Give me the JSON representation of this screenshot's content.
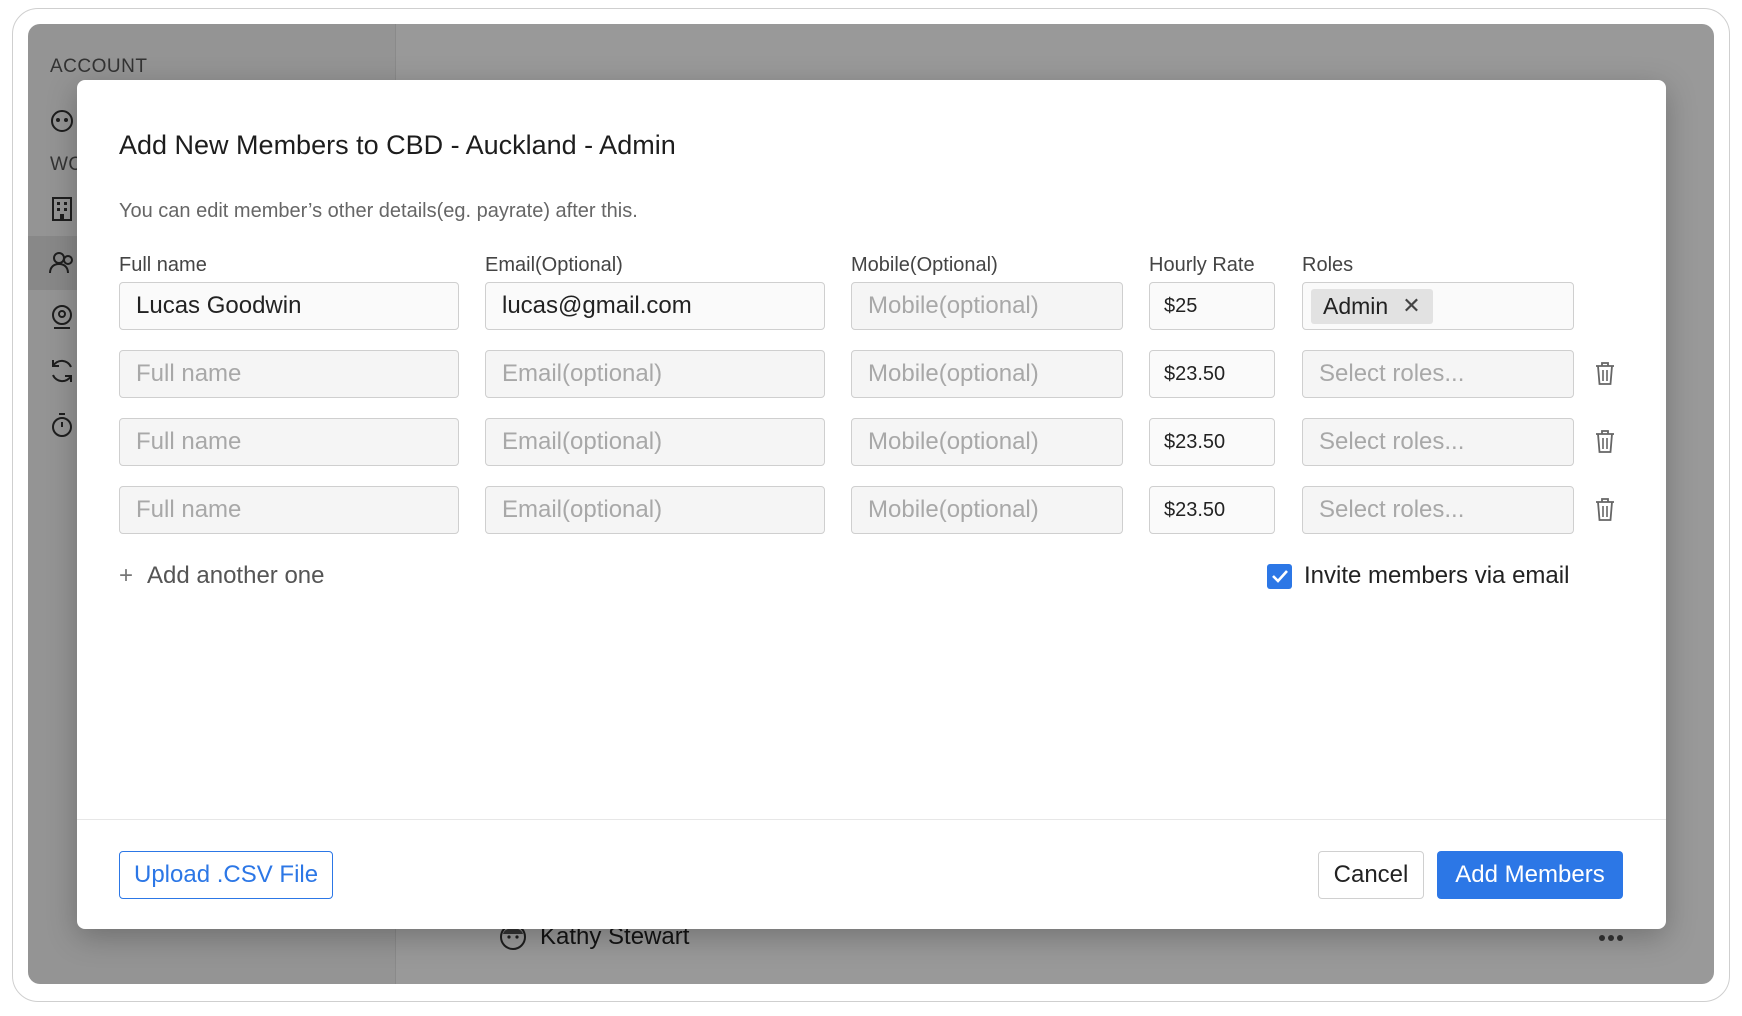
{
  "sidebar": {
    "section_account": "ACCOUNT",
    "section_workspace": "WO"
  },
  "background": {
    "member_name": "Kathy Stewart"
  },
  "modal": {
    "title": "Add New Members to CBD - Auckland - Admin",
    "subtitle": "You can edit member’s other details(eg. payrate) after this.",
    "columns": {
      "full_name": "Full name",
      "email": "Email(Optional)",
      "mobile": "Mobile(Optional)",
      "hourly_rate": "Hourly Rate",
      "roles": "Roles"
    },
    "placeholders": {
      "full_name": "Full name",
      "email": "Email(optional)",
      "mobile": "Mobile(optional)",
      "roles": "Select roles..."
    },
    "rows": [
      {
        "full_name": "Lucas Goodwin",
        "email": "lucas@gmail.com",
        "mobile": "",
        "hourly_rate": "$25",
        "roles": [
          "Admin"
        ]
      },
      {
        "full_name": "",
        "email": "",
        "mobile": "",
        "hourly_rate": "$23.50",
        "roles": []
      },
      {
        "full_name": "",
        "email": "",
        "mobile": "",
        "hourly_rate": "$23.50",
        "roles": []
      },
      {
        "full_name": "",
        "email": "",
        "mobile": "",
        "hourly_rate": "$23.50",
        "roles": []
      }
    ],
    "add_another_label": "Add another one",
    "invite_label": "Invite members via email",
    "invite_checked": true,
    "upload_label": "Upload .CSV File",
    "cancel_label": "Cancel",
    "submit_label": "Add Members"
  },
  "colors": {
    "accent": "#2c77e6"
  }
}
